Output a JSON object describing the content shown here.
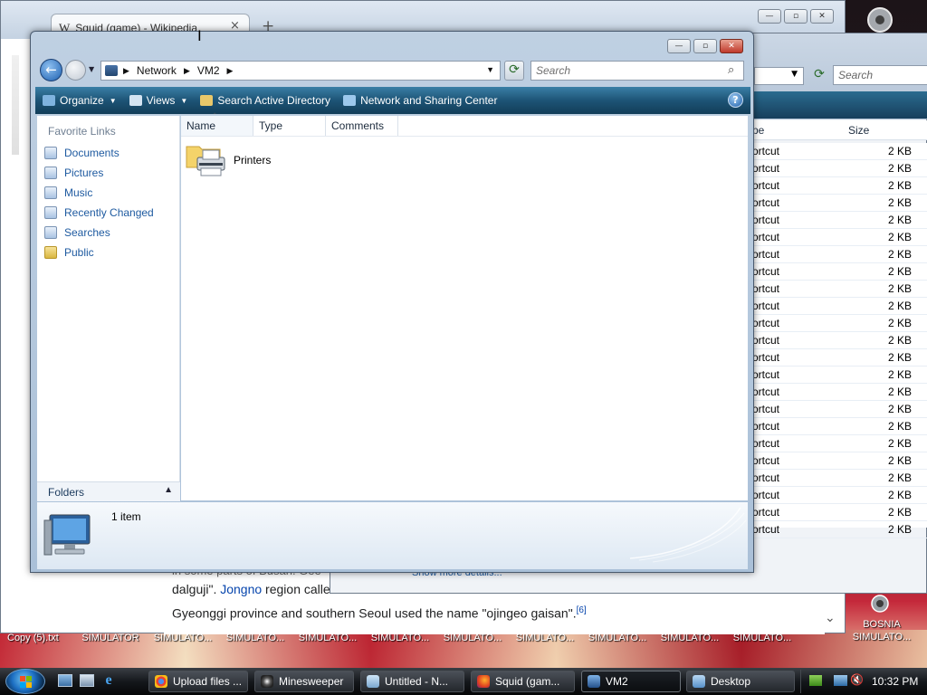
{
  "desktop": {
    "top_labels": [
      "Copy (5).txt",
      "SIMULATOR",
      "SIMULATO...",
      "SIMULATO...",
      "SIMULATO...",
      "SIMULATO...",
      "SIMULATO...",
      "SIMULATO...",
      "SIMULATO...",
      "SIMULATO...",
      "SIMULATO..."
    ],
    "bosnia_label_1": "BOSNIA",
    "bosnia_label_2": "SIMULATO..."
  },
  "browser": {
    "tab_title": "Squid (game) - Wikipedia",
    "tab_close": "×",
    "new_tab": "+",
    "article_line1_link": "Jongno",
    "article_line1_prefix": "dalguji\". ",
    "article_line1_suffix": " region calle",
    "article_line2": "Gyeonggi province and southern Seoul used the name \"ojingeo gaisan\".",
    "article_ref": "[6]",
    "cut_text": "in some parts of Busan. Gee",
    "scroll_down": "⌄"
  },
  "explorer_behind": {
    "search_placeholder": "Search",
    "col_type": "pe",
    "col_size": "Size",
    "detail_hint": "Show more details...",
    "rows": [
      {
        "type": "ortcut",
        "size": "2 KB"
      },
      {
        "type": "ortcut",
        "size": "2 KB"
      },
      {
        "type": "ortcut",
        "size": "2 KB"
      },
      {
        "type": "ortcut",
        "size": "2 KB"
      },
      {
        "type": "ortcut",
        "size": "2 KB"
      },
      {
        "type": "ortcut",
        "size": "2 KB"
      },
      {
        "type": "ortcut",
        "size": "2 KB"
      },
      {
        "type": "ortcut",
        "size": "2 KB"
      },
      {
        "type": "ortcut",
        "size": "2 KB"
      },
      {
        "type": "ortcut",
        "size": "2 KB"
      },
      {
        "type": "ortcut",
        "size": "2 KB"
      },
      {
        "type": "ortcut",
        "size": "2 KB"
      },
      {
        "type": "ortcut",
        "size": "2 KB"
      },
      {
        "type": "ortcut",
        "size": "2 KB"
      },
      {
        "type": "ortcut",
        "size": "2 KB"
      },
      {
        "type": "ortcut",
        "size": "2 KB"
      },
      {
        "type": "ortcut",
        "size": "2 KB"
      },
      {
        "type": "ortcut",
        "size": "2 KB"
      },
      {
        "type": "ortcut",
        "size": "2 KB"
      },
      {
        "type": "ortcut",
        "size": "2 KB"
      },
      {
        "type": "ortcut",
        "size": "2 KB"
      },
      {
        "type": "ortcut",
        "size": "2 KB"
      },
      {
        "type": "ortcut",
        "size": "2 KB"
      }
    ]
  },
  "window": {
    "breadcrumb": [
      "Network",
      "VM2"
    ],
    "search_placeholder": "Search",
    "toolbar": {
      "organize": "Organize",
      "views": "Views",
      "search_ad": "Search Active Directory",
      "network_center": "Network and Sharing Center",
      "help": "?"
    },
    "favorite_links_title": "Favorite Links",
    "favorite_links": [
      "Documents",
      "Pictures",
      "Music",
      "Recently Changed",
      "Searches",
      "Public"
    ],
    "folders_label": "Folders",
    "columns": [
      "Name",
      "Type",
      "Comments"
    ],
    "items": [
      {
        "name": "Printers"
      }
    ],
    "status": "1 item"
  },
  "taskbar": {
    "buttons": [
      "Upload files ...",
      "Minesweeper",
      "Untitled - N...",
      "Squid (gam...",
      "VM2",
      "Desktop"
    ],
    "clock": "10:32 PM"
  },
  "colors": {
    "accent": "#1e5aa0",
    "toolbar": "#1d5476",
    "taskbar": "#15181c"
  }
}
